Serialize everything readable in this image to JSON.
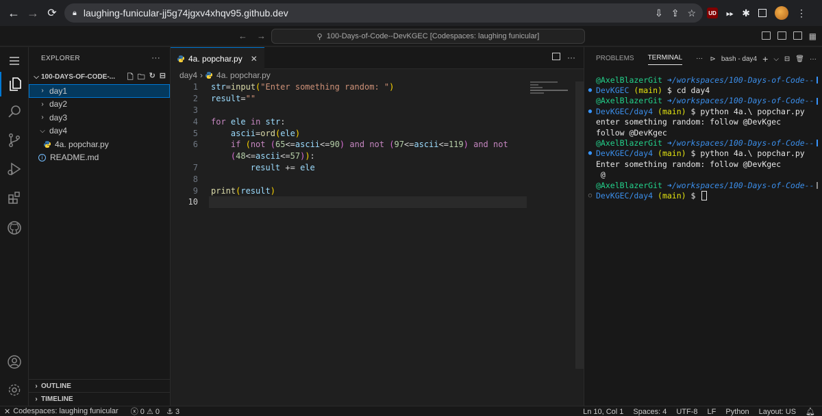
{
  "browser": {
    "url": "laughing-funicular-jj5g74jgxv4xhqv95.github.dev",
    "ublock_label": "UD"
  },
  "titlebar": {
    "command_center": "100-Days-of-Code--DevKGEC [Codespaces: laughing funicular]"
  },
  "sidebar": {
    "title": "EXPLORER",
    "folder": "100-DAYS-OF-CODE-...",
    "items": [
      {
        "label": "day1"
      },
      {
        "label": "day2"
      },
      {
        "label": "day3"
      },
      {
        "label": "day4"
      },
      {
        "label": "4a. popchar.py"
      },
      {
        "label": "README.md"
      }
    ],
    "outline": "OUTLINE",
    "timeline": "TIMELINE"
  },
  "editor": {
    "tab_label": "4a. popchar.py",
    "breadcrumb_folder": "day4",
    "breadcrumb_file": "4a. popchar.py",
    "line_numbers": [
      "1",
      "2",
      "3",
      "4",
      "5",
      "6",
      "",
      "7",
      "8",
      "9",
      "10"
    ]
  },
  "panel": {
    "tabs": [
      "PROBLEMS",
      "TERMINAL"
    ],
    "terminal_name": "bash - day4",
    "terminal": {
      "user": "@AxelBlazerGit",
      "arrow": "➜",
      "path1_a": "/workspaces/100-Days-of-Code--",
      "path1_b": "DevKGEC",
      "branch": "(main)",
      "cmd1": " $ cd day4",
      "path2_b": "DevKGEC/day4",
      "cmd2": " $ python 4a.\\ popchar.py",
      "out1": "enter something random: follow @DevKgec",
      "out2": "follow @DevKgec",
      "out3": "Enter something random: follow @DevKgec",
      "out4": " @",
      "prompt_end": " $ "
    }
  },
  "status": {
    "remote": "Codespaces: laughing funicular",
    "errors": "0",
    "warnings": "0",
    "ports": "3",
    "position": "Ln 10, Col 1",
    "spaces": "Spaces: 4",
    "encoding": "UTF-8",
    "eol": "LF",
    "language": "Python",
    "layout": "Layout: US"
  },
  "colors": {
    "accent": "#0078d4",
    "terminal_green": "#23d18b",
    "terminal_blue": "#3b8eea",
    "terminal_yellow": "#e5e510"
  }
}
